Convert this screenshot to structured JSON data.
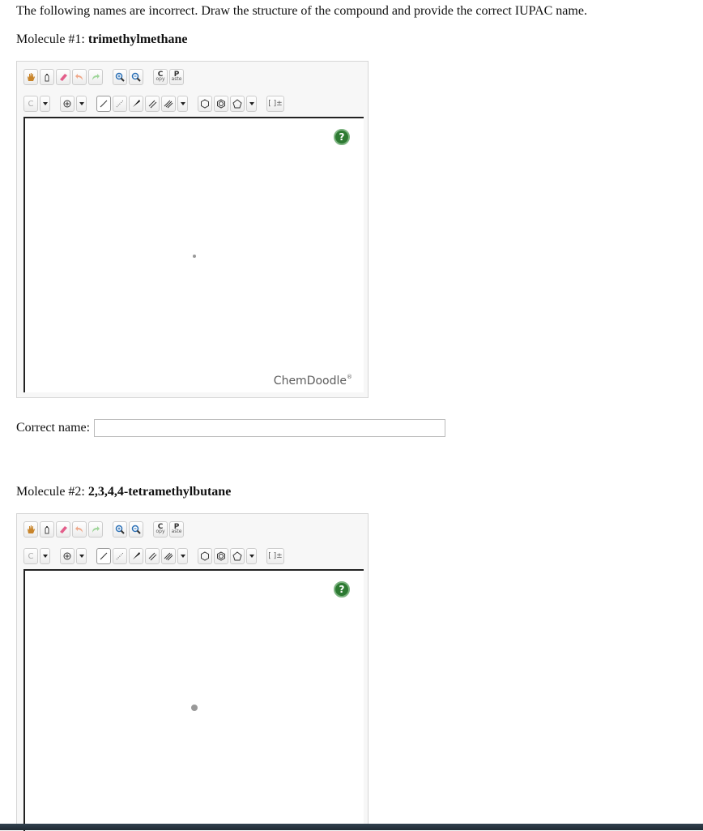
{
  "instructions": "The following names are incorrect. Draw the structure of the compound and provide the correct IUPAC name.",
  "molecules": [
    {
      "prefix": "Molecule #1: ",
      "name": "trimethylmethane"
    },
    {
      "prefix": "Molecule #2: ",
      "name": "2,3,4,4-tetramethylbutane"
    }
  ],
  "toolbar": {
    "copy_main": "C",
    "copy_sub": "opy",
    "paste_main": "P",
    "paste_sub": "aste",
    "element": "C",
    "brackets": "[ ]±"
  },
  "help_label": "?",
  "brand": "ChemDoodle",
  "brand_mark": "®",
  "correct_name_label": "Correct name:",
  "correct_name_value": "",
  "colors": {
    "help_green": "#2d7a32",
    "eraser_pink": "#e35d8a",
    "zoom_blue": "#2a6fb5"
  }
}
